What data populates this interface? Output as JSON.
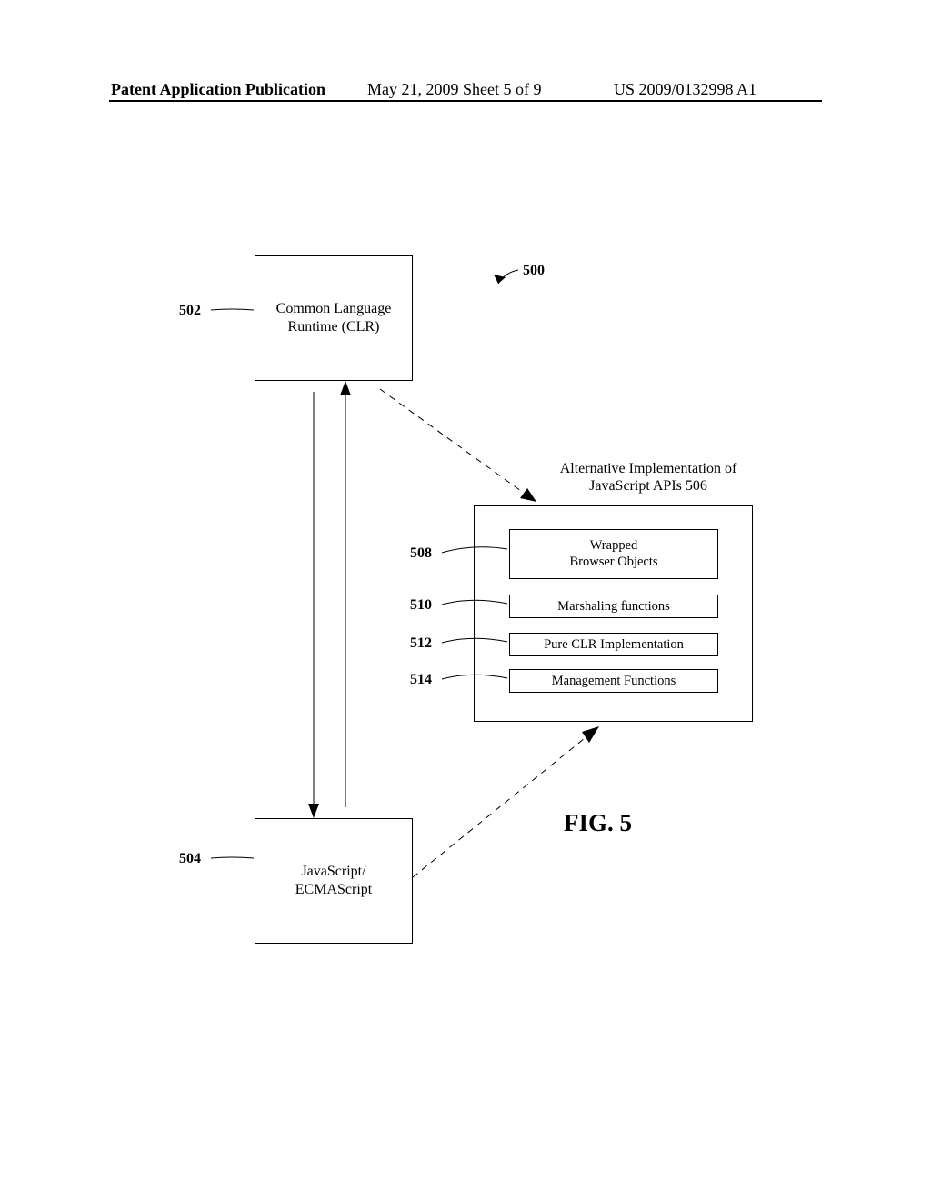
{
  "header": {
    "left": "Patent Application Publication",
    "mid": "May 21, 2009  Sheet 5 of 9",
    "right": "US 2009/0132998 A1"
  },
  "figure": {
    "ref500": "500",
    "ref502": "502",
    "ref504": "504",
    "ref508": "508",
    "ref510": "510",
    "ref512": "512",
    "ref514": "514",
    "clr": "Common Language\nRuntime (CLR)",
    "js": "JavaScript/\nECMAScript",
    "alt_title": "Alternative Implementation of JavaScript APIs 506",
    "b508": "Wrapped\nBrowser Objects",
    "b510": "Marshaling functions",
    "b512": "Pure CLR Implementation",
    "b514": "Management Functions",
    "fig": "FIG. 5"
  }
}
